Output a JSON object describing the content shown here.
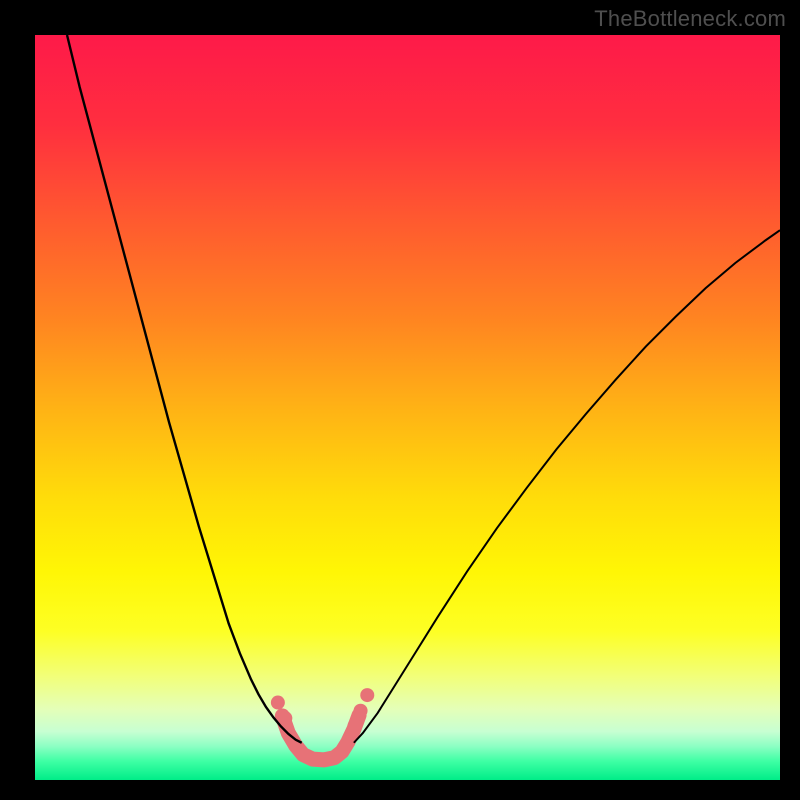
{
  "watermark": "TheBottleneck.com",
  "chart_data": {
    "type": "line",
    "title": "",
    "xlabel": "",
    "ylabel": "",
    "xlim": [
      0,
      100
    ],
    "ylim": [
      0,
      100
    ],
    "grid": false,
    "legend": false,
    "background_gradient_stops": [
      {
        "offset": 0.0,
        "color": "#fe1a49"
      },
      {
        "offset": 0.12,
        "color": "#ff2e3f"
      },
      {
        "offset": 0.25,
        "color": "#ff5a2f"
      },
      {
        "offset": 0.38,
        "color": "#ff8421"
      },
      {
        "offset": 0.5,
        "color": "#ffb215"
      },
      {
        "offset": 0.62,
        "color": "#ffdc0a"
      },
      {
        "offset": 0.72,
        "color": "#fff605"
      },
      {
        "offset": 0.8,
        "color": "#fdff24"
      },
      {
        "offset": 0.86,
        "color": "#f2ff78"
      },
      {
        "offset": 0.905,
        "color": "#e4ffb8"
      },
      {
        "offset": 0.935,
        "color": "#c7ffd2"
      },
      {
        "offset": 0.955,
        "color": "#8bffc3"
      },
      {
        "offset": 0.975,
        "color": "#3effa4"
      },
      {
        "offset": 1.0,
        "color": "#00ed88"
      }
    ],
    "series": [
      {
        "name": "left-curve",
        "stroke": "#000000",
        "stroke_width": 2.4,
        "x": [
          4.3,
          6.0,
          8.0,
          10.0,
          12.0,
          14.0,
          16.0,
          18.0,
          20.0,
          22.0,
          24.0,
          26.0,
          27.5,
          29.0,
          30.0,
          31.0,
          32.0,
          33.0,
          34.0,
          35.0,
          35.8
        ],
        "y": [
          100.0,
          93.0,
          85.5,
          78.0,
          70.5,
          63.0,
          55.5,
          48.0,
          41.0,
          34.0,
          27.5,
          21.0,
          17.0,
          13.5,
          11.5,
          9.8,
          8.4,
          7.2,
          6.2,
          5.4,
          5.0
        ]
      },
      {
        "name": "right-curve",
        "stroke": "#000000",
        "stroke_width": 2.0,
        "x": [
          42.8,
          44.0,
          46.0,
          48.0,
          51.0,
          54.0,
          58.0,
          62.0,
          66.0,
          70.0,
          74.0,
          78.0,
          82.0,
          86.0,
          90.0,
          94.0,
          98.0,
          100.0
        ],
        "y": [
          5.0,
          6.3,
          9.0,
          12.2,
          17.0,
          21.8,
          28.0,
          33.8,
          39.2,
          44.4,
          49.2,
          53.8,
          58.2,
          62.2,
          66.0,
          69.4,
          72.4,
          73.8
        ]
      },
      {
        "name": "valley-band",
        "stroke": "#e77277",
        "stroke_width": 15,
        "linecap": "round",
        "linejoin": "round",
        "x": [
          33.2,
          34.0,
          35.0,
          36.0,
          37.3,
          38.8,
          40.2,
          41.2,
          42.0,
          42.8,
          43.5
        ],
        "y": [
          8.6,
          6.3,
          4.6,
          3.4,
          2.8,
          2.7,
          3.0,
          3.8,
          5.1,
          6.8,
          8.7
        ]
      }
    ],
    "markers": [
      {
        "name": "left-dot-upper",
        "x": 32.6,
        "y": 10.4,
        "r": 7,
        "fill": "#e77277"
      },
      {
        "name": "left-dot-lower",
        "x": 33.6,
        "y": 8.3,
        "r": 7,
        "fill": "#e77277"
      },
      {
        "name": "right-dot-lower",
        "x": 42.9,
        "y": 7.3,
        "r": 7,
        "fill": "#e77277"
      },
      {
        "name": "right-dot-mid",
        "x": 43.7,
        "y": 9.3,
        "r": 7,
        "fill": "#e77277"
      },
      {
        "name": "right-dot-upper",
        "x": 44.6,
        "y": 11.4,
        "r": 7,
        "fill": "#e77277"
      }
    ]
  }
}
